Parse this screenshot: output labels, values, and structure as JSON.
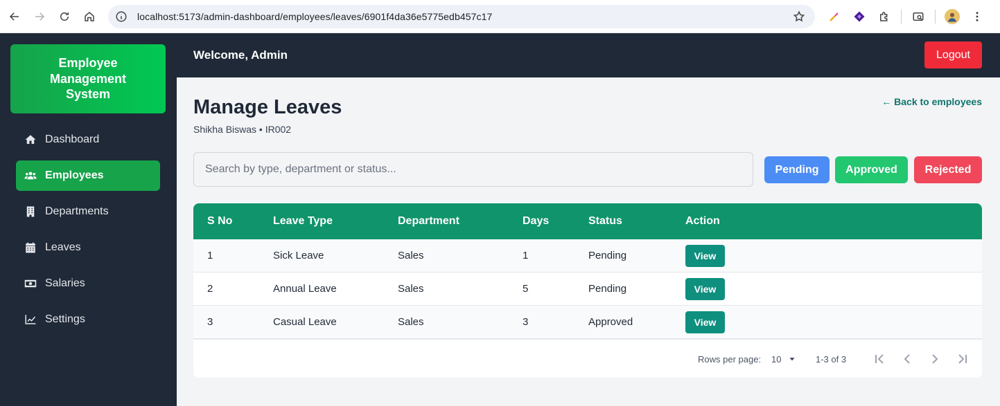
{
  "browser": {
    "url": "localhost:5173/admin-dashboard/employees/leaves/6901f4da36e5775edb457c17"
  },
  "brand": {
    "title": "Employee Management System"
  },
  "sidebar": {
    "items": [
      {
        "label": "Dashboard",
        "icon": "home-icon",
        "active": false
      },
      {
        "label": "Employees",
        "icon": "users-icon",
        "active": true
      },
      {
        "label": "Departments",
        "icon": "building-icon",
        "active": false
      },
      {
        "label": "Leaves",
        "icon": "calendar-icon",
        "active": false
      },
      {
        "label": "Salaries",
        "icon": "money-icon",
        "active": false
      },
      {
        "label": "Settings",
        "icon": "chart-line-icon",
        "active": false
      }
    ]
  },
  "topbar": {
    "welcome": "Welcome, Admin",
    "logout_label": "Logout"
  },
  "page": {
    "title": "Manage Leaves",
    "subtitle": "Shikha Biswas • IR002",
    "back_link": "← Back to employees"
  },
  "search": {
    "placeholder": "Search by type, department or status..."
  },
  "filters": {
    "pending": "Pending",
    "approved": "Approved",
    "rejected": "Rejected"
  },
  "table": {
    "headers": [
      "S No",
      "Leave Type",
      "Department",
      "Days",
      "Status",
      "Action"
    ],
    "rows": [
      {
        "sno": "1",
        "type": "Sick Leave",
        "department": "Sales",
        "days": "1",
        "status": "Pending",
        "action": "View"
      },
      {
        "sno": "2",
        "type": "Annual Leave",
        "department": "Sales",
        "days": "5",
        "status": "Pending",
        "action": "View"
      },
      {
        "sno": "3",
        "type": "Casual Leave",
        "department": "Sales",
        "days": "3",
        "status": "Approved",
        "action": "View"
      }
    ]
  },
  "pagination": {
    "rows_per_page_label": "Rows per page:",
    "rows_per_page": "10",
    "range": "1-3 of 3"
  },
  "colors": {
    "sidebar_bg": "#1f2937",
    "accent_green": "#16a34a",
    "table_header": "#0f946b",
    "logout_red": "#ef2b3a",
    "pending_blue": "#4b8cf5",
    "approved_green": "#22c770",
    "rejected_red": "#f0475a"
  }
}
